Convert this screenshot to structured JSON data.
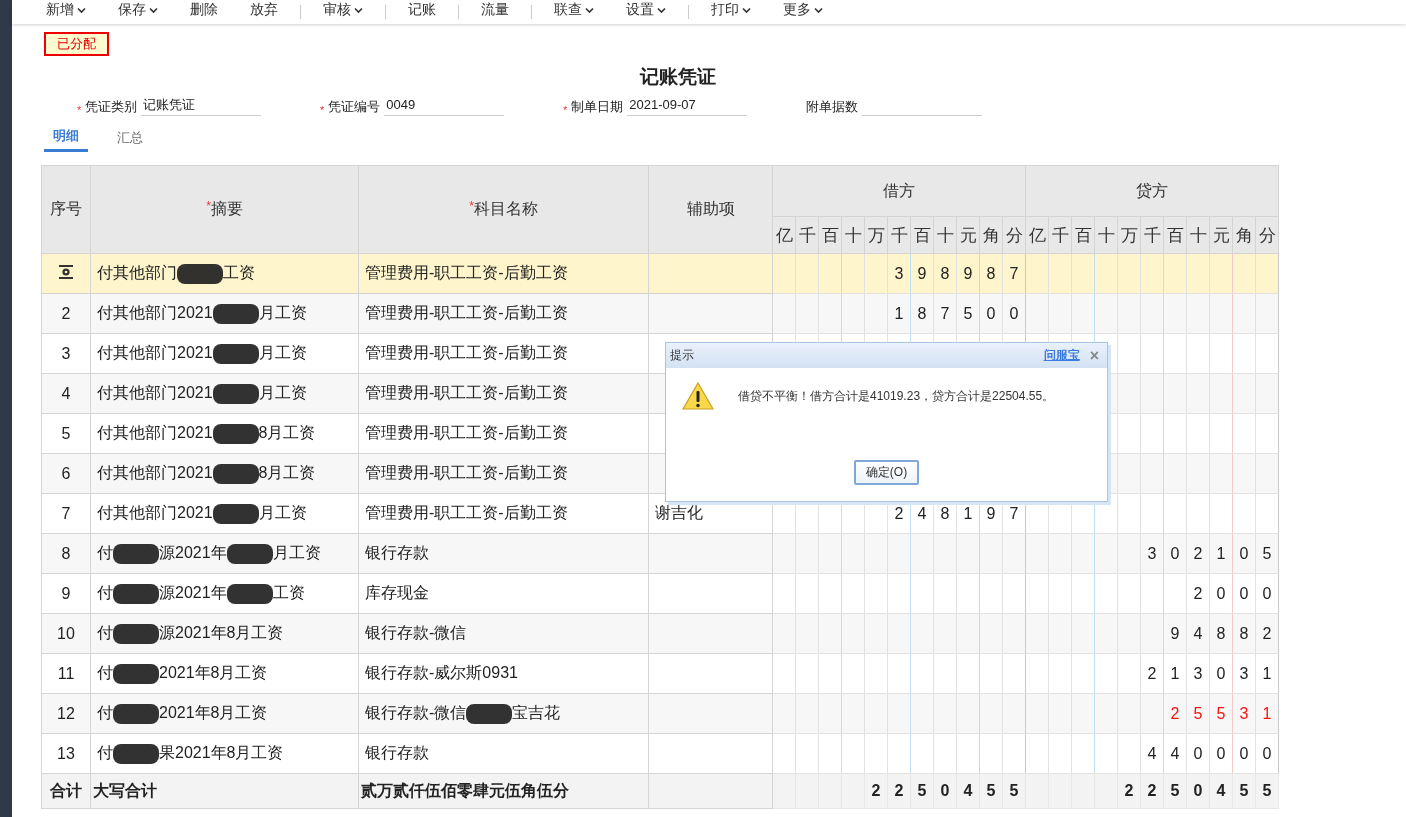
{
  "toolbar": [
    {
      "label": "新增",
      "dropdown": true,
      "separator_before": false
    },
    {
      "label": "保存",
      "dropdown": true,
      "separator_before": false
    },
    {
      "label": "删除",
      "dropdown": false,
      "separator_before": false
    },
    {
      "label": "放弃",
      "dropdown": false,
      "separator_before": false
    },
    {
      "label": "审核",
      "dropdown": true,
      "separator_before": true
    },
    {
      "label": "记账",
      "dropdown": false,
      "separator_before": true
    },
    {
      "label": "流量",
      "dropdown": false,
      "separator_before": true
    },
    {
      "label": "联查",
      "dropdown": true,
      "separator_before": true
    },
    {
      "label": "设置",
      "dropdown": true,
      "separator_before": false
    },
    {
      "label": "打印",
      "dropdown": true,
      "separator_before": true
    },
    {
      "label": "更多",
      "dropdown": true,
      "separator_before": false
    }
  ],
  "status_badge": "已分配",
  "title": "记账凭证",
  "fields": [
    {
      "required_mark": "*",
      "label": "凭证类别",
      "value": "记账凭证"
    },
    {
      "required_mark": "*",
      "label": "凭证编号",
      "value": "0049"
    },
    {
      "required_mark": "*",
      "label": "制单日期",
      "value": "2021-09-07"
    },
    {
      "label": "附单据数"
    }
  ],
  "tabs": [
    {
      "label": "明细",
      "selected": true
    },
    {
      "label": "汇总",
      "selected": false
    }
  ],
  "table": {
    "columns": [
      {
        "label": "序号"
      },
      {
        "required_mark": "*",
        "label": "摘要"
      },
      {
        "required_mark": "*",
        "label": "科目名称"
      },
      {
        "label": "辅助项"
      }
    ],
    "amount_groups": [
      {
        "label": "借方",
        "units": [
          "亿",
          "千",
          "百",
          "十",
          "万",
          "千",
          "百",
          "十",
          "元",
          "角",
          "分"
        ]
      },
      {
        "label": "贷方",
        "units": [
          "亿",
          "千",
          "百",
          "十",
          "万",
          "千",
          "百",
          "十",
          "元",
          "角",
          "分"
        ]
      }
    ],
    "rows": [
      {
        "selected": true,
        "summary": [
          "付其他部门",
          "工资"
        ],
        "account": [
          "管理费用-职工工资-后勤工资"
        ],
        "debit": [
          "3",
          "9",
          "8",
          "9",
          "8",
          "7"
        ]
      },
      {
        "no": "2",
        "selected": false,
        "summary": [
          "付其他部门2021",
          "月工资"
        ],
        "account": [
          "管理费用-职工工资-后勤工资"
        ],
        "debit": [
          "1",
          "8",
          "7",
          "5",
          "0",
          "0"
        ]
      },
      {
        "no": "3",
        "selected": false,
        "summary": [
          "付其他部门2021",
          "月工资"
        ],
        "account": [
          "管理费用-职工工资-后勤工资"
        ]
      },
      {
        "no": "4",
        "selected": false,
        "summary": [
          "付其他部门2021",
          "月工资"
        ],
        "account": [
          "管理费用-职工工资-后勤工资"
        ]
      },
      {
        "no": "5",
        "selected": false,
        "summary": [
          "付其他部门2021",
          "8月工资"
        ],
        "account": [
          "管理费用-职工工资-后勤工资"
        ]
      },
      {
        "no": "6",
        "selected": false,
        "summary": [
          "付其他部门2021",
          "8月工资"
        ],
        "account": [
          "管理费用-职工工资-后勤工资"
        ]
      },
      {
        "no": "7",
        "selected": false,
        "summary": [
          "付其他部门2021",
          "月工资"
        ],
        "account": [
          "管理费用-职工工资-后勤工资"
        ],
        "aux": [
          "谢吉化"
        ],
        "debit": [
          "2",
          "4",
          "8",
          "1",
          "9",
          "7"
        ]
      },
      {
        "no": "8",
        "selected": false,
        "summary": [
          "付",
          "源2021年",
          "月工资"
        ],
        "account": [
          "银行存款"
        ],
        "credit": [
          "3",
          "0",
          "2",
          "1",
          "0",
          "5"
        ],
        "negative": false
      },
      {
        "no": "9",
        "selected": false,
        "summary": [
          "付",
          "源2021年",
          "工资"
        ],
        "account": [
          "库存现金"
        ],
        "credit": [
          "2",
          "0",
          "0",
          "0"
        ],
        "negative": false
      },
      {
        "no": "10",
        "selected": false,
        "summary": [
          "付",
          "源2021年8月工资"
        ],
        "account": [
          "银行存款-微信"
        ],
        "credit": [
          "9",
          "4",
          "8",
          "8",
          "2"
        ],
        "negative": false
      },
      {
        "no": "11",
        "selected": false,
        "summary": [
          "付",
          "2021年8月工资"
        ],
        "account": [
          "银行存款-威尔斯0931"
        ],
        "credit": [
          "2",
          "1",
          "3",
          "0",
          "3",
          "1"
        ],
        "negative": false
      },
      {
        "no": "12",
        "selected": false,
        "summary": [
          "付",
          "2021年8月工资"
        ],
        "account": [
          "银行存款-微信",
          "宝吉花"
        ],
        "credit": [
          "2",
          "5",
          "5",
          "3",
          "1"
        ],
        "negative": true
      },
      {
        "no": "13",
        "selected": false,
        "summary": [
          "付",
          "果2021年8月工资"
        ],
        "account": [
          "银行存款"
        ],
        "credit": [
          "4",
          "4",
          "0",
          "0",
          "0",
          "0"
        ],
        "negative": false
      }
    ],
    "totals": {
      "label": "合计",
      "caption": "大写合计",
      "amount_words": "贰万贰仟伍佰零肆元伍角伍分",
      "debit": [
        "2",
        "2",
        "5",
        "0",
        "4",
        "5",
        "5"
      ],
      "credit": [
        "2",
        "2",
        "5",
        "0",
        "4",
        "5",
        "5"
      ]
    }
  },
  "dialog": {
    "title": "提示",
    "link": "问服宝",
    "close": "×",
    "message": "借贷不平衡！借方合计是41019.23，贷方合计是22504.55。",
    "button": "确定(O)"
  }
}
